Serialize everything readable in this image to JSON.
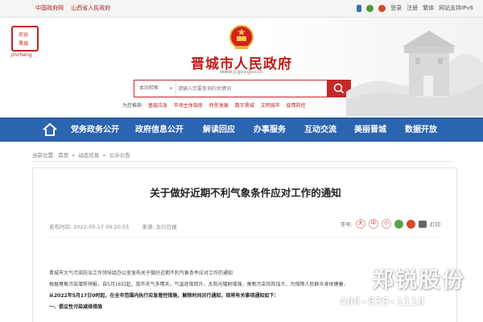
{
  "topbar": {
    "links": [
      "中国政府网",
      "山西省人民政府"
    ],
    "login": "登录",
    "register": "注册",
    "traditional": "繁体",
    "ipv6": "网站支持IPv6"
  },
  "header": {
    "title": "晋城市人民政府",
    "domain": "www.jcgov.gov.cn",
    "seal_line1": "农谷",
    "seal_line2": "晋城",
    "seal_sub": "Jincheng"
  },
  "search": {
    "category": "本站检索",
    "placeholder": "请输入您要查询的关键词"
  },
  "quick_links": {
    "label": "为您推荐:",
    "items": [
      "基层应急",
      "市场主体指南",
      "转型发展",
      "数字晋城",
      "文明城市",
      "疫情防控"
    ]
  },
  "nav": {
    "items": [
      "党务政务公开",
      "政府信息公开",
      "解读回应",
      "办事服务",
      "互动交流",
      "美丽晋城",
      "数据开放"
    ]
  },
  "breadcrumb": [
    "当前位置:",
    "首页",
    "»",
    "动态信息",
    "»",
    "公示公告"
  ],
  "article": {
    "title": "关于做好近期不利气象条件应对工作的通知",
    "published": "发布时间: 2022-05-17 09:20:55",
    "source": "来源: 太行日报",
    "font_label": "字号:",
    "font_sizes": [
      "大",
      "中",
      "小"
    ],
    "print": "打印",
    "paragraphs": [
      "晋城市大气污染防治工作领导组办公室发布关于做好近期不利气象条件应对工作的通知",
      "根据臭氧污染潜势预报，自5月16日起，我市天气多晴天，气温逐渐回升，太阳光辐射增强，臭氧污染风险加大，为保障人民群众身体健康，",
      "从2022年5月17日0时起，在全市范围内执行应急管控措施，解除时间另行通知，现将有关事项通知如下：",
      "一、倡议性污染减排措施"
    ]
  },
  "watermark": {
    "name": "郑锐股份",
    "phone": "400-839-1110"
  }
}
